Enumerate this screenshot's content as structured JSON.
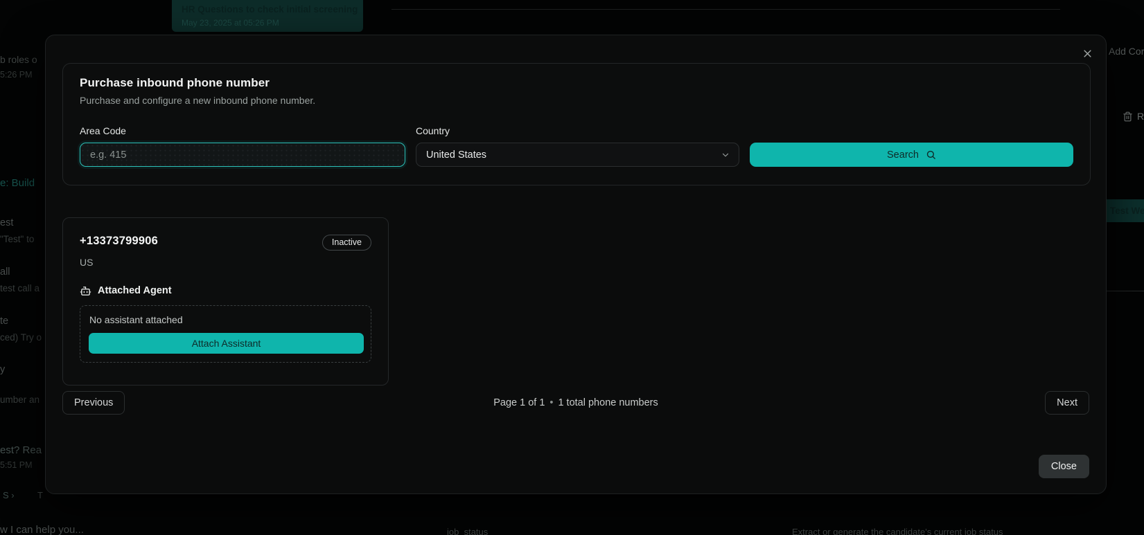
{
  "colors": {
    "accent_teal": "#0fb5ac",
    "accent_text_dark": "#0e2a28",
    "modal_bg": "#0b0c0c",
    "page_bg": "#030404",
    "focus_border": "#2cc2b9",
    "highlight_row_bg": "#0c2f2c"
  },
  "icons": {
    "close": "x-lines",
    "chevron_down": "chevron",
    "search": "magnifier",
    "bot": "robot-head",
    "trash": "trash-can"
  },
  "backdrop": {
    "header_card": {
      "title": "HR Questions to check initial screening",
      "timestamp": "May 23, 2025 at 05:26 PM"
    },
    "left_fragments": [
      {
        "text": "b roles o"
      },
      {
        "text": "5:26 PM"
      },
      {
        "text": "e: Build"
      },
      {
        "text": "est"
      },
      {
        "text": "\"Test\" to"
      },
      {
        "text": "all"
      },
      {
        "text": "test call a"
      },
      {
        "text": "te"
      },
      {
        "text": "ced) Try o"
      },
      {
        "text": "y"
      },
      {
        "text": "umber an"
      },
      {
        "text": "est? Rea"
      },
      {
        "text": "5:51 PM"
      },
      {
        "text": "S ›"
      },
      {
        "text": "T"
      }
    ],
    "right_fragments": {
      "add_contact": "Add Cor",
      "remove": "Re",
      "highlighted_row": "Test We"
    },
    "bottom_fragments": {
      "chat_text": "w I can help you...",
      "field_name": "job_status",
      "field_description": "Extract or generate the candidate's current job status"
    }
  },
  "modal": {
    "title": "Purchase inbound phone number",
    "subtitle": "Purchase and configure a new inbound phone number.",
    "form": {
      "area_code_label": "Area Code",
      "area_code_placeholder": "e.g. 415",
      "area_code_value": "",
      "country_label": "Country",
      "country_value": "United States",
      "search_label": "Search"
    },
    "phone_card": {
      "number": "+13373799906",
      "status": "Inactive",
      "country": "US",
      "attached_agent_label": "Attached Agent",
      "no_assistant_text": "No assistant attached",
      "attach_button_label": "Attach Assistant"
    },
    "pagination": {
      "previous_label": "Previous",
      "page_info": "Page 1 of 1",
      "separator": "•",
      "total_info": "1 total phone numbers",
      "next_label": "Next"
    },
    "close_label": "Close"
  }
}
